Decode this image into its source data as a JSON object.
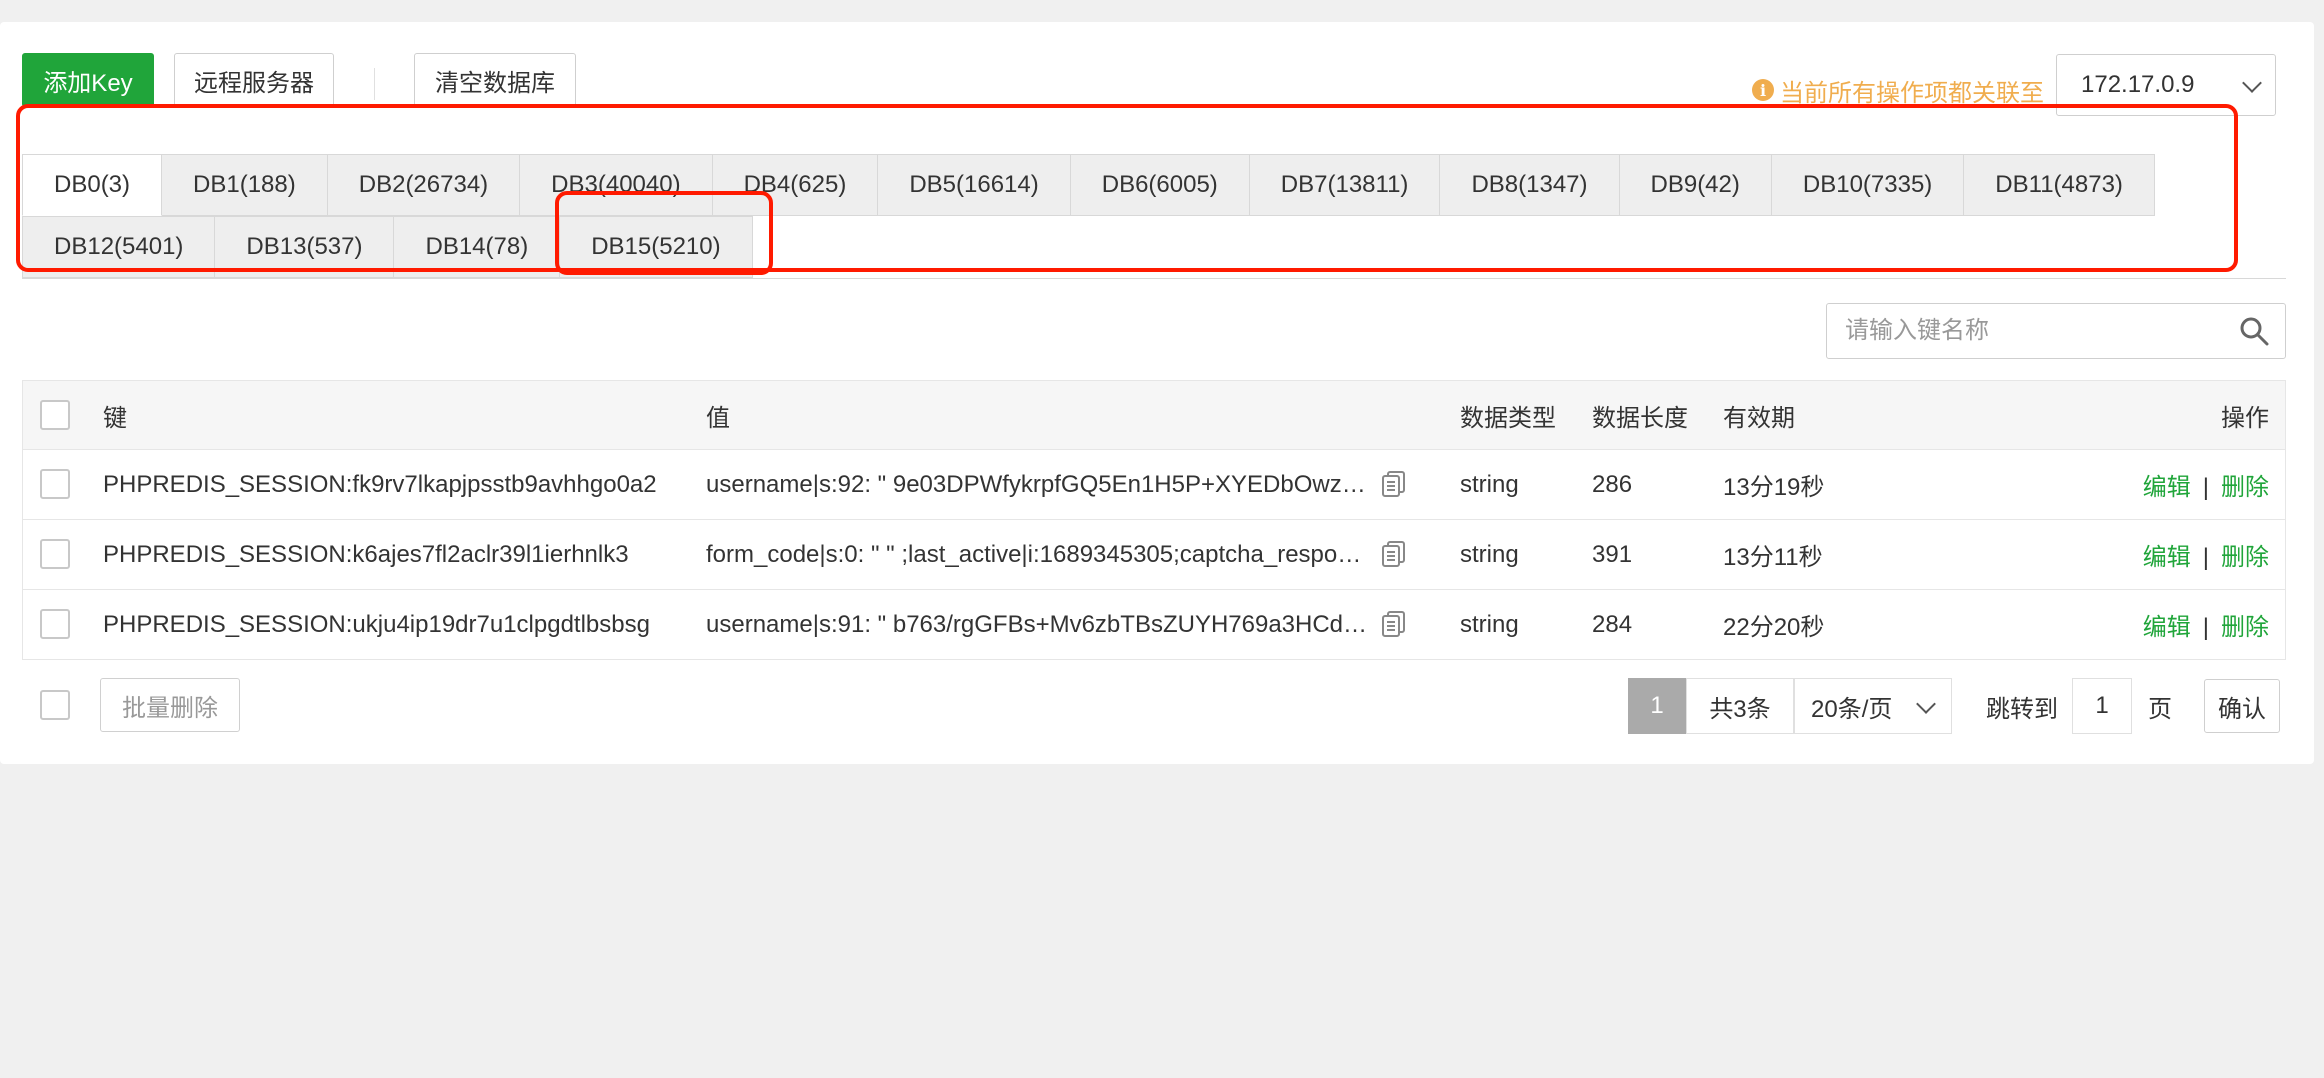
{
  "toolbar": {
    "add_key": "添加Key",
    "remote_server": "远程服务器",
    "clear_db": "清空数据库",
    "notice": "当前所有操作项都关联至",
    "server": "172.17.0.9"
  },
  "tabs": {
    "row1": [
      "DB0(3)",
      "DB1(188)",
      "DB2(26734)",
      "DB3(40040)",
      "DB4(625)",
      "DB5(16614)",
      "DB6(6005)",
      "DB7(13811)",
      "DB8(1347)",
      "DB9(42)",
      "DB10(7335)",
      "DB11(4873)"
    ],
    "row2": [
      "DB12(5401)",
      "DB13(537)",
      "DB14(78)",
      "DB15(5210)"
    ],
    "active": "DB0(3)"
  },
  "search": {
    "placeholder": "请输入键名称"
  },
  "table": {
    "headers": {
      "key": "键",
      "value": "值",
      "type": "数据类型",
      "length": "数据长度",
      "ttl": "有效期",
      "ops": "操作"
    },
    "rows": [
      {
        "key": "PHPREDIS_SESSION:fk9rv7lkapjpsstb9avhhgo0a2",
        "value": "username|s:92: \" 9e03DPWfykrpfGQ5En1H5P+XYEDbOwz…",
        "type": "string",
        "length": "286",
        "ttl": "13分19秒",
        "edit": "编辑",
        "sep": "|",
        "delete": "删除"
      },
      {
        "key": "PHPREDIS_SESSION:k6ajes7fl2aclr39l1ierhnlk3",
        "value": "form_code|s:0: \"  \" ;last_active|i:1689345305;captcha_respo…",
        "type": "string",
        "length": "391",
        "ttl": "13分11秒",
        "edit": "编辑",
        "sep": "|",
        "delete": "删除"
      },
      {
        "key": "PHPREDIS_SESSION:ukju4ip19dr7u1clpgdtlbsbsg",
        "value": "username|s:91: \" b763/rgGFBs+Mv6zbTBsZUYH769a3HCd…",
        "type": "string",
        "length": "284",
        "ttl": "22分20秒",
        "edit": "编辑",
        "sep": "|",
        "delete": "删除"
      }
    ]
  },
  "footer": {
    "batch_delete": "批量删除",
    "current_page": "1",
    "total": "共3条",
    "page_size": "20条/页",
    "jump_to": "跳转到",
    "jump_value": "1",
    "page_unit": "页",
    "confirm": "确认"
  },
  "colors": {
    "primary": "#20a53a",
    "warning": "#f0ad4e",
    "highlight": "#ff1a00"
  }
}
